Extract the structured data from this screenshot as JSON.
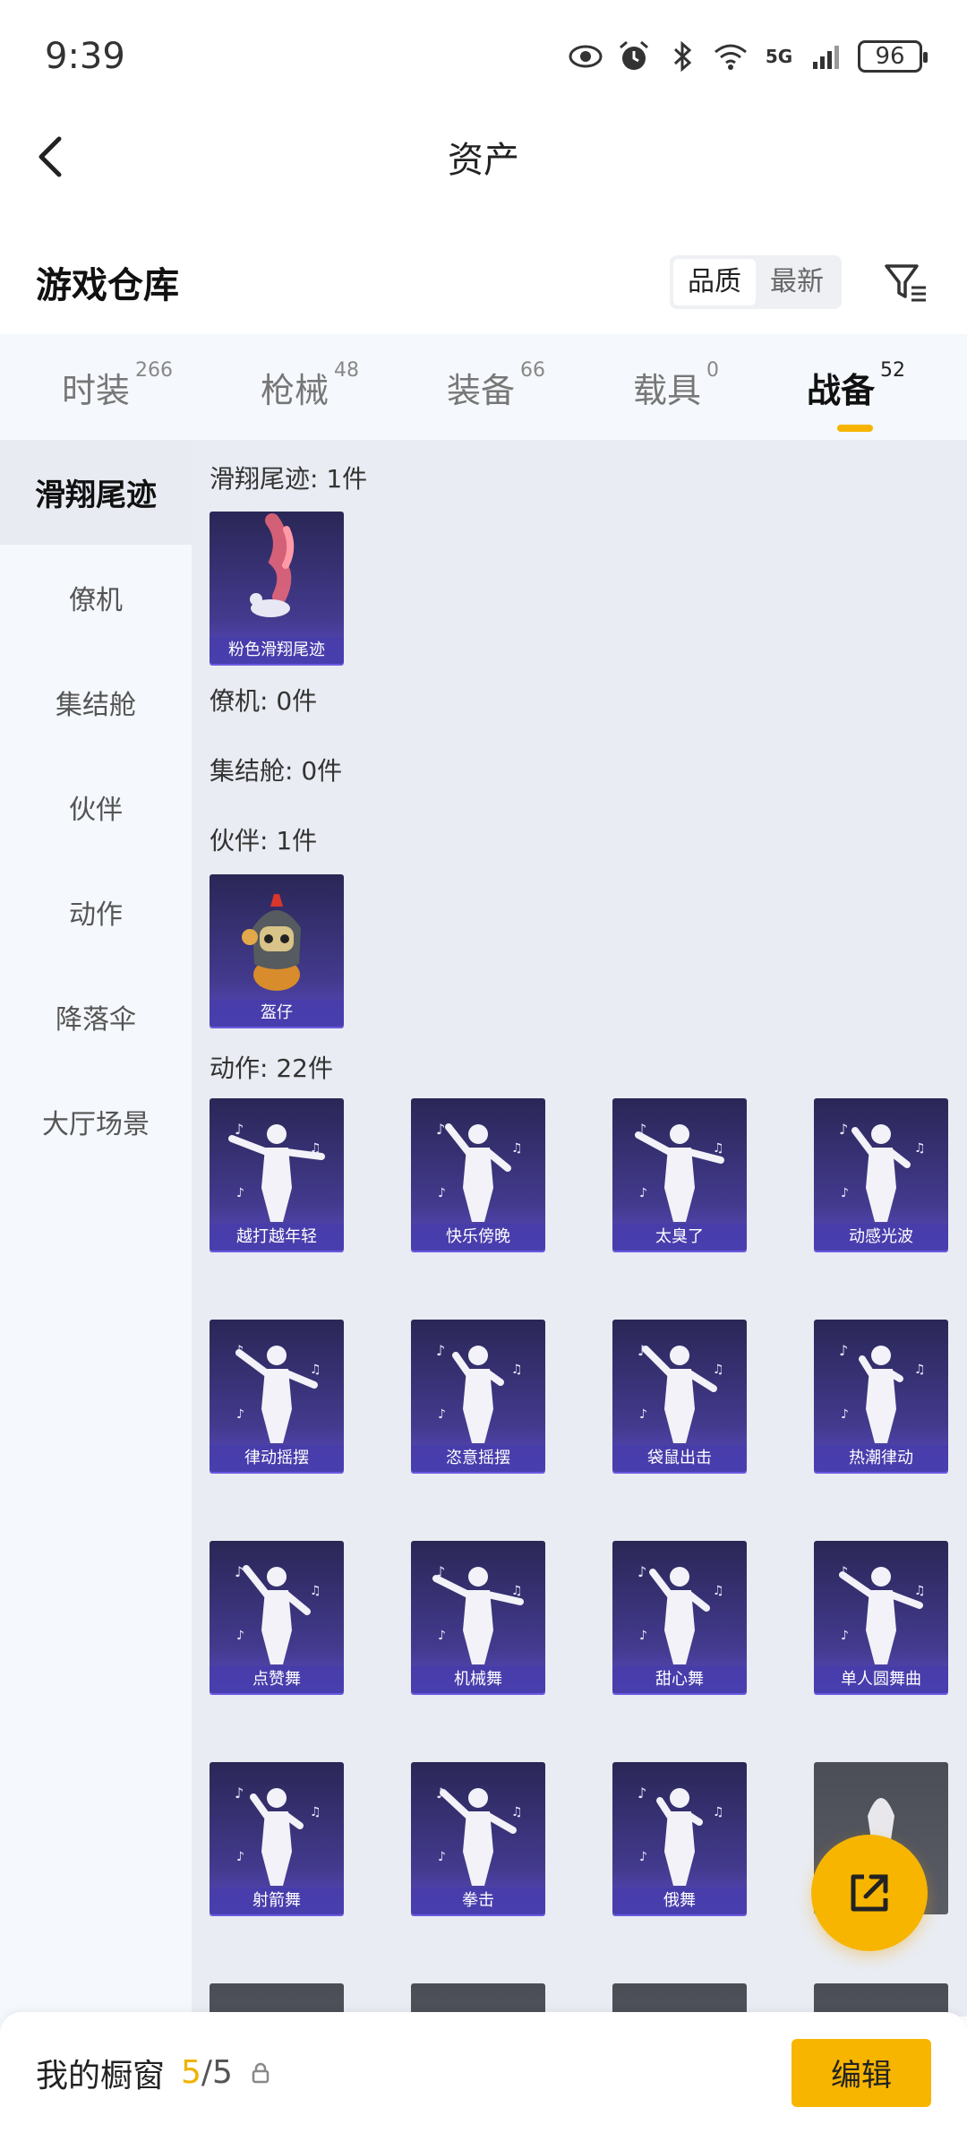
{
  "status": {
    "time": "9:39",
    "net": "5G",
    "battery": "96"
  },
  "header": {
    "title": "资产"
  },
  "warehouse": {
    "title": "游戏仓库",
    "sort": [
      "品质",
      "最新"
    ]
  },
  "tabs": [
    {
      "label": "时装",
      "count": "266"
    },
    {
      "label": "枪械",
      "count": "48"
    },
    {
      "label": "装备",
      "count": "66"
    },
    {
      "label": "载具",
      "count": "0"
    },
    {
      "label": "战备",
      "count": "52"
    }
  ],
  "sidebar": [
    "滑翔尾迹",
    "僚机",
    "集结舱",
    "伙伴",
    "动作",
    "降落伞",
    "大厅场景"
  ],
  "sections": {
    "glide": {
      "label": "滑翔尾迹: 1件",
      "items": [
        "粉色滑翔尾迹"
      ]
    },
    "wingman": {
      "label": "僚机: 0件"
    },
    "capsule": {
      "label": "集结舱: 0件"
    },
    "partner": {
      "label": "伙伴: 1件",
      "items": [
        "盔仔"
      ]
    },
    "emote": {
      "label": "动作: 22件",
      "items": [
        "越打越年轻",
        "快乐傍晚",
        "太臭了",
        "动感光波",
        "律动摇摆",
        "恣意摇摆",
        "袋鼠出击",
        "热潮律动",
        "点赞舞",
        "机械舞",
        "甜心舞",
        "单人圆舞曲",
        "射箭舞",
        "拳击",
        "俄舞"
      ]
    }
  },
  "bottom": {
    "label": "我的橱窗",
    "used": "5",
    "total": "/5",
    "edit": "编辑"
  },
  "colors": {
    "accent": "#f7b500",
    "card": "#433a8e",
    "sidebar": "#f5f8fc",
    "content": "#e9ecf2"
  }
}
